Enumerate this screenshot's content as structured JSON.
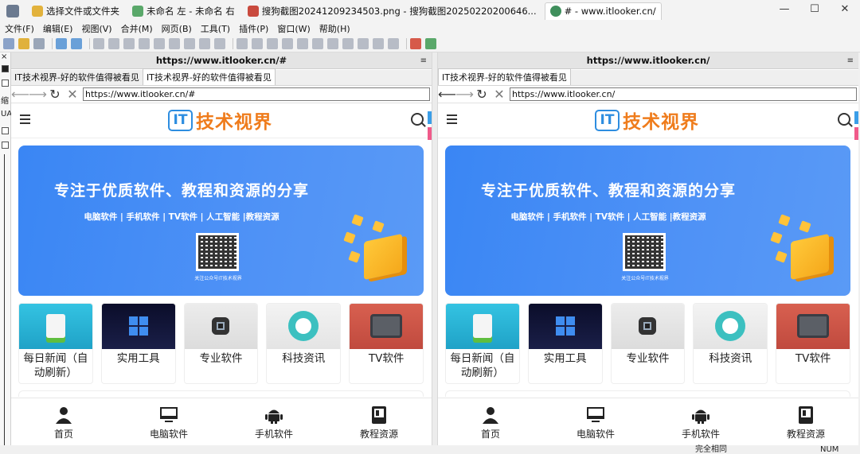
{
  "tabs": [
    {
      "label": "选择文件或文件夹",
      "active": false
    },
    {
      "label": "未命名 左 - 未命名 右",
      "active": false
    },
    {
      "label": "搜狗截图20241209234503.png - 搜狗截图20250220200646...",
      "active": false
    },
    {
      "label": "# - www.itlooker.cn/",
      "active": true
    }
  ],
  "window_controls": {
    "minimize": "—",
    "maximize": "☐",
    "close": "✕"
  },
  "menu": [
    "文件(F)",
    "编辑(E)",
    "视图(V)",
    "合并(M)",
    "网页(B)",
    "工具(T)",
    "插件(P)",
    "窗口(W)",
    "帮助(H)"
  ],
  "left_strip": {
    "close": "×",
    "label1": "缩",
    "label2": "UA"
  },
  "panes": [
    {
      "title": "https://www.itlooker.cn/#",
      "menu_icon": "≡",
      "tabs": [
        {
          "label": "IT技术视界-好的软件值得被看见",
          "active": false
        },
        {
          "label": "IT技术视界-好的软件值得被看见",
          "active": true
        }
      ],
      "url": "https://www.itlooker.cn/#"
    },
    {
      "title": "https://www.itlooker.cn/",
      "menu_icon": "≡",
      "tabs": [
        {
          "label": "IT技术视界-好的软件值得被看见",
          "active": true
        }
      ],
      "url": "https://www.itlooker.cn/"
    }
  ],
  "nav": {
    "back": "⟵",
    "forward": "⟶",
    "reload": "↻",
    "stop": "✕"
  },
  "site": {
    "logo_mark": "IT",
    "logo_text": "技术视界",
    "banner_title": "专注于优质软件、教程和资源的分享",
    "banner_sub": "电脑软件 | 手机软件 | TV软件 | 人工智能 |教程资源",
    "qr_caption": "关注公众号IT技术视界",
    "categories": [
      "每日新闻（自动刷新）",
      "实用工具",
      "专业软件",
      "科技资讯",
      "TV软件"
    ],
    "bottom_nav": [
      {
        "label": "首页",
        "icon": "user-icon"
      },
      {
        "label": "电脑软件",
        "icon": "monitor-icon"
      },
      {
        "label": "手机软件",
        "icon": "android-icon"
      },
      {
        "label": "教程资源",
        "icon": "book-icon"
      }
    ]
  },
  "status": {
    "compare": "完全相同",
    "num": "NUM"
  },
  "colors": {
    "banner": "#4a8ff5",
    "logo_blue": "#2d8de0",
    "logo_orange": "#ef7c1c"
  }
}
